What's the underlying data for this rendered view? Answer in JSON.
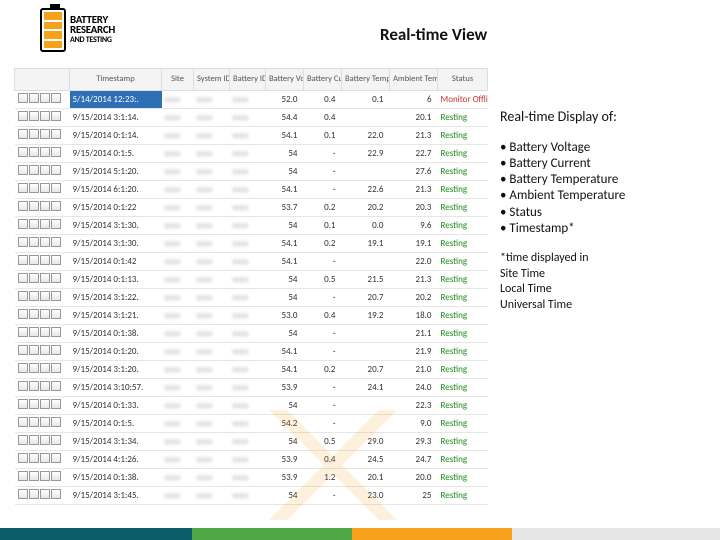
{
  "brand": {
    "line1": "BATTERY",
    "line2": "RESEARCH",
    "line3": "AND TESTING"
  },
  "title": "Real-time View",
  "columns": [
    "",
    "Timestamp",
    "Site",
    "System ID",
    "Battery ID",
    "Battery Voltage",
    "Battery Current",
    "Battery Temperature",
    "Ambient Temperature",
    "Status"
  ],
  "rows": [
    {
      "ts": "5/14/2014 12:23:.",
      "bv": "52.0",
      "bc": "0.4",
      "bt": "0.1",
      "at": "6",
      "st": "Monitor Offline",
      "cls": "st-mo",
      "sel": true
    },
    {
      "ts": "9/15/2014 3:1:14.",
      "bv": "54.4",
      "bc": "0.4",
      "bt": "",
      "at": "20.1",
      "st": "Resting",
      "cls": "st-res"
    },
    {
      "ts": "9/15/2014 0:1:14.",
      "bv": "54.1",
      "bc": "0.1",
      "bt": "22.0",
      "at": "21.3",
      "st": "Resting",
      "cls": "st-res"
    },
    {
      "ts": "9/15/2014 0:1:5.",
      "bv": "54",
      "bc": "-",
      "bt": "22.9",
      "at": "22.7",
      "st": "Resting",
      "cls": "st-res"
    },
    {
      "ts": "9/15/2014 5:1:20.",
      "bv": "54",
      "bc": "-",
      "bt": "",
      "at": "27.6",
      "st": "Resting",
      "cls": "st-res"
    },
    {
      "ts": "9/15/2014 6:1:20.",
      "bv": "54.1",
      "bc": "-",
      "bt": "22.6",
      "at": "21.3",
      "st": "Resting",
      "cls": "st-res"
    },
    {
      "ts": "9/15/2014 0:1:22",
      "bv": "53.7",
      "bc": "0.2",
      "bt": "20.2",
      "at": "20.3",
      "st": "Resting",
      "cls": "st-res"
    },
    {
      "ts": "9/15/2014 3:1:30.",
      "bv": "54",
      "bc": "0.1",
      "bt": "0.0",
      "at": "9.6",
      "st": "Resting",
      "cls": "st-res"
    },
    {
      "ts": "9/15/2014 3:1:30.",
      "bv": "54.1",
      "bc": "0.2",
      "bt": "19.1",
      "at": "19.1",
      "st": "Resting",
      "cls": "st-res"
    },
    {
      "ts": "9/15/2014 0:1:42",
      "bv": "54.1",
      "bc": "-",
      "bt": "",
      "at": "22.0",
      "st": "Resting",
      "cls": "st-res"
    },
    {
      "ts": "9/15/2014 0:1:13.",
      "bv": "54",
      "bc": "0.5",
      "bt": "21.5",
      "at": "21.3",
      "st": "Resting",
      "cls": "st-res"
    },
    {
      "ts": "9/15/2014 3:1:22.",
      "bv": "54",
      "bc": "-",
      "bt": "20.7",
      "at": "20.2",
      "st": "Resting",
      "cls": "st-res"
    },
    {
      "ts": "9/15/2014 3:1:21.",
      "bv": "53.0",
      "bc": "0.4",
      "bt": "19.2",
      "at": "18.0",
      "st": "Resting",
      "cls": "st-res"
    },
    {
      "ts": "9/15/2014 0:1:38.",
      "bv": "54",
      "bc": "-",
      "bt": "",
      "at": "21.1",
      "st": "Resting",
      "cls": "st-res"
    },
    {
      "ts": "9/15/2014 0:1:20.",
      "bv": "54.1",
      "bc": "-",
      "bt": "",
      "at": "21.9",
      "st": "Resting",
      "cls": "st-res"
    },
    {
      "ts": "9/15/2014 3:1:20.",
      "bv": "54.1",
      "bc": "0.2",
      "bt": "20.7",
      "at": "21.0",
      "st": "Resting",
      "cls": "st-res"
    },
    {
      "ts": "9/15/2014 3:10:57.",
      "bv": "53.9",
      "bc": "-",
      "bt": "24.1",
      "at": "24.0",
      "st": "Resting",
      "cls": "st-res"
    },
    {
      "ts": "9/15/2014 0:1:33.",
      "bv": "54",
      "bc": "-",
      "bt": "",
      "at": "22.3",
      "st": "Resting",
      "cls": "st-res"
    },
    {
      "ts": "9/15/2014 0:1:5.",
      "bv": "54.2",
      "bc": "-",
      "bt": "",
      "at": "9.0",
      "st": "Resting",
      "cls": "st-res"
    },
    {
      "ts": "9/15/2014 3:1:34.",
      "bv": "54",
      "bc": "0.5",
      "bt": "29.0",
      "at": "29.3",
      "st": "Resting",
      "cls": "st-res"
    },
    {
      "ts": "9/15/2014 4:1:26.",
      "bv": "53.9",
      "bc": "0.4",
      "bt": "24.5",
      "at": "24.7",
      "st": "Resting",
      "cls": "st-res"
    },
    {
      "ts": "9/15/2014 0:1:38.",
      "bv": "53.9",
      "bc": "1.2",
      "bt": "20.1",
      "at": "20.0",
      "st": "Resting",
      "cls": "st-res"
    },
    {
      "ts": "9/15/2014 3:1:45.",
      "bv": "54",
      "bc": "-",
      "bt": "23.0",
      "at": "25",
      "st": "Resting",
      "cls": "st-res"
    }
  ],
  "side": {
    "heading": "Real-time Display of:",
    "bullets": [
      "Battery Voltage",
      "Battery Current",
      "Battery Temperature",
      "Ambient Temperature",
      "Status",
      "Timestamp*"
    ],
    "footnote": "*time displayed in",
    "footlines": [
      "Site Time",
      "Local Time",
      "Universal Time"
    ]
  }
}
